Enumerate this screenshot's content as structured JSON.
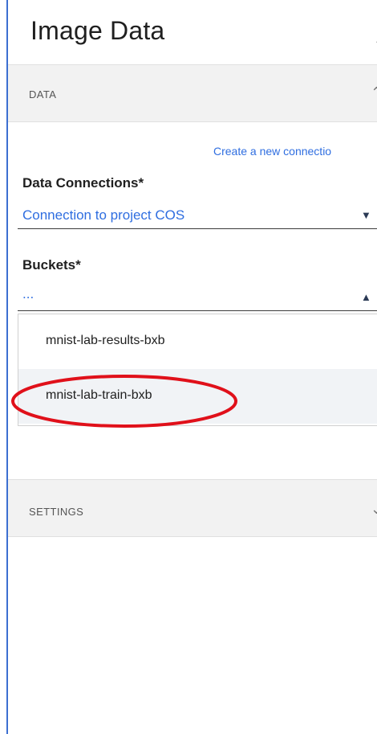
{
  "header": {
    "title": "Image Data",
    "chevron_icon": "chevron-up-icon"
  },
  "sections": {
    "data": {
      "label": "DATA",
      "chevron_icon": "chevron-up-icon"
    },
    "settings": {
      "label": "SETTINGS",
      "chevron_icon": "chevron-down-icon"
    }
  },
  "create_link": {
    "text": "Create a new connectio"
  },
  "data_connections": {
    "label": "Data Connections*",
    "value": "Connection to project COS",
    "caret_icon": "caret-down-icon"
  },
  "buckets": {
    "label": "Buckets*",
    "value": "...",
    "caret_icon": "caret-up-icon",
    "options": [
      {
        "label": "mnist-lab-results-bxb"
      },
      {
        "label": "mnist-lab-train-bxb"
      }
    ]
  },
  "annotation": {
    "color": "#e0101a"
  }
}
